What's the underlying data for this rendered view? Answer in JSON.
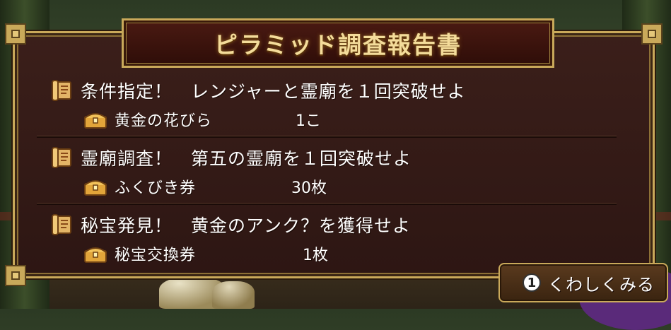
{
  "report": {
    "title": "ピラミッド調査報告書",
    "quests": [
      {
        "objective": "条件指定！　レンジャーと霊廟を１回突破せよ",
        "reward_name": "黄金の花びら",
        "reward_qty": "1こ"
      },
      {
        "objective": "霊廟調査！　第五の霊廟を１回突破せよ",
        "reward_name": "ふくびき券",
        "reward_qty": "30枚"
      },
      {
        "objective": "秘宝発見！　黄金のアンク？を獲得せよ",
        "reward_name": "秘宝交換券",
        "reward_qty": "1枚"
      }
    ]
  },
  "details_button": {
    "key": "1",
    "label": "くわしくみる"
  },
  "icons": {
    "quest": "scroll-icon",
    "reward": "treasure-chest-icon"
  },
  "colors": {
    "panel_bg": "#3b1f1a",
    "frame_gold": "#c9a95a",
    "title_text": "#f4dc9a",
    "body_text": "#ffffff"
  }
}
